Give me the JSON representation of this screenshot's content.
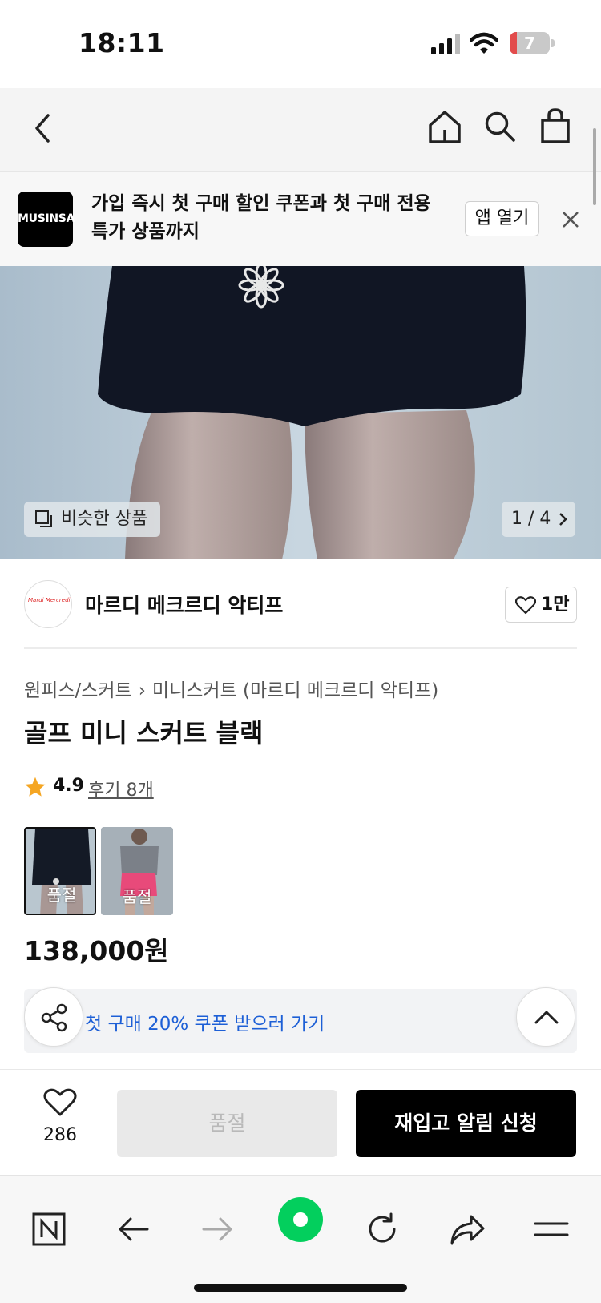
{
  "status_bar": {
    "time": "18:11",
    "battery": "7"
  },
  "app_banner": {
    "logo_text": "MUSINSA",
    "message": "가입 즉시 첫 구매 할인 쿠폰과 첫 구매 전용 특가 상품까지",
    "open_app_label": "앱 열기"
  },
  "hero": {
    "similar_label": "비슷한 상품",
    "counter": "1 / 4"
  },
  "brand": {
    "avatar_text": "Mardi Mercredi Actif",
    "name": "마르디 메크르디 악티프",
    "likes": "1만"
  },
  "breadcrumb": {
    "category": "원피스/스커트",
    "subcategory": "미니스커트 (마르디 메크르디 악티프)"
  },
  "product": {
    "title": "골프 미니 스커트 블랙",
    "rating": "4.9",
    "reviews": "후기 8개",
    "price": "138,000원",
    "swatches": [
      {
        "label": "품절"
      },
      {
        "label": "품절"
      }
    ]
  },
  "coupon": {
    "text": "첫 구매 20% 쿠폰 받으러 가기"
  },
  "buy_bar": {
    "wish_count": "286",
    "soldout_label": "품절",
    "restock_label": "재입고 알림 신청"
  },
  "colors": {
    "accent_blue": "#1d5fd6",
    "star": "#f5a623",
    "naver_green": "#03cf5d"
  }
}
